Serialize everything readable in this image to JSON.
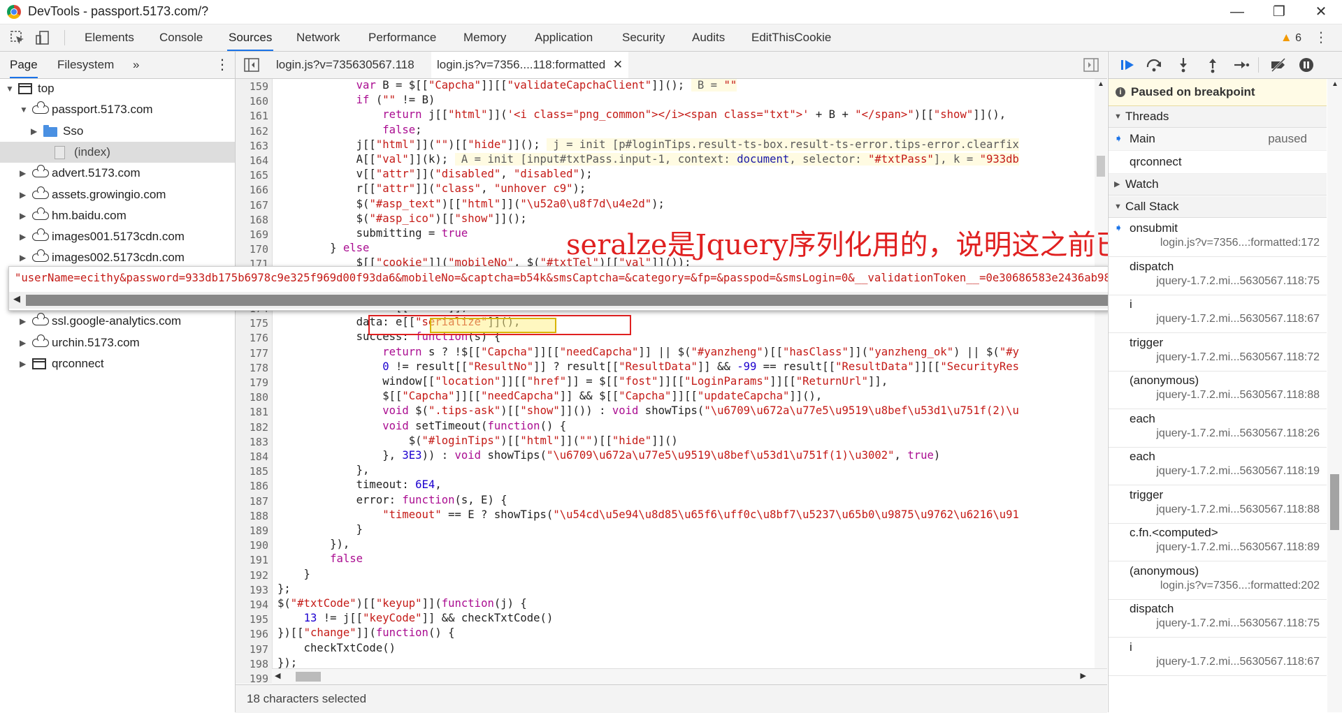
{
  "window": {
    "title": "DevTools - passport.5173.com/?",
    "minimize": "—",
    "maximize": "❐",
    "close": "✕"
  },
  "main_tabs": [
    "Elements",
    "Console",
    "Sources",
    "Network",
    "Performance",
    "Memory",
    "Application",
    "Security",
    "Audits",
    "EditThisCookie"
  ],
  "active_tab": "Sources",
  "warnings": {
    "icon": "warning-icon",
    "count": "6"
  },
  "navigator": {
    "tabs": [
      "Page",
      "Filesystem"
    ],
    "more": "»",
    "tree": [
      {
        "label": "top",
        "depth": 0,
        "icon": "frame",
        "arrow": "▼"
      },
      {
        "label": "passport.5173.com",
        "depth": 1,
        "icon": "cloud",
        "arrow": "▼"
      },
      {
        "label": "Sso",
        "depth": 2,
        "icon": "folder",
        "arrow": "▶"
      },
      {
        "label": "(index)",
        "depth": 3,
        "icon": "file",
        "arrow": "",
        "selected": true
      },
      {
        "label": "advert.5173.com",
        "depth": 1,
        "icon": "cloud",
        "arrow": "▶"
      },
      {
        "label": "assets.growingio.com",
        "depth": 1,
        "icon": "cloud",
        "arrow": "▶"
      },
      {
        "label": "hm.baidu.com",
        "depth": 1,
        "icon": "cloud",
        "arrow": "▶"
      },
      {
        "label": "images001.5173cdn.com",
        "depth": 1,
        "icon": "cloud",
        "arrow": "▶"
      },
      {
        "label": "images002.5173cdn.com",
        "depth": 1,
        "icon": "cloud",
        "arrow": "▶"
      },
      {
        "label": "ssl.google-analytics.com",
        "depth": 1,
        "icon": "cloud",
        "arrow": "▶",
        "row": 11
      },
      {
        "label": "urchin.5173.com",
        "depth": 1,
        "icon": "cloud",
        "arrow": "▶",
        "row": 12
      },
      {
        "label": "qrconnect",
        "depth": 1,
        "icon": "frame",
        "arrow": "▶",
        "row": 13
      }
    ]
  },
  "editor": {
    "tabs": [
      {
        "label": "login.js?v=735630567.118",
        "active": false
      },
      {
        "label": "login.js?v=7356....118:formatted",
        "active": true
      }
    ],
    "line_numbers": [
      "159",
      "160",
      "161",
      "162",
      "163",
      "164",
      "165",
      "166",
      "167",
      "168",
      "169",
      "170",
      "171",
      "",
      "",
      "174",
      "175",
      "176",
      "177",
      "178",
      "179",
      "180",
      "181",
      "182",
      "183",
      "184",
      "185",
      "186",
      "187",
      "188",
      "189",
      "190",
      "191",
      "192",
      "193",
      "194",
      "195",
      "196",
      "197",
      "198",
      "199"
    ],
    "status": "18 characters selected"
  },
  "popover": {
    "text": "\"userName=ecithy&password=933db175b6978c9e325f969d00f93da6&mobileNo=&captcha=b54k&smsCaptcha=&category=&fp=&passpod=&smsLogin=0&__validationToken__=0e30686583e2436ab980ca650f9a6ecb&__validati"
  },
  "annotation": "seralze是Jquery序列化用的，说明这之前已加密",
  "debugger": {
    "paused": "Paused on breakpoint",
    "sections": {
      "threads": "Threads",
      "watch": "Watch",
      "call_stack": "Call Stack"
    },
    "threads": [
      {
        "name": "Main",
        "status": "paused"
      },
      {
        "name": "qrconnect",
        "status": ""
      }
    ],
    "call_stack": [
      {
        "name": "onsubmit",
        "loc": "login.js?v=7356...:formatted:172"
      },
      {
        "name": "dispatch",
        "loc": "jquery-1.7.2.mi...5630567.118:75"
      },
      {
        "name": "i",
        "loc": "jquery-1.7.2.mi...5630567.118:67"
      },
      {
        "name": "trigger",
        "loc": "jquery-1.7.2.mi...5630567.118:72"
      },
      {
        "name": "(anonymous)",
        "loc": "jquery-1.7.2.mi...5630567.118:88"
      },
      {
        "name": "each",
        "loc": "jquery-1.7.2.mi...5630567.118:26"
      },
      {
        "name": "each",
        "loc": "jquery-1.7.2.mi...5630567.118:19"
      },
      {
        "name": "trigger",
        "loc": "jquery-1.7.2.mi...5630567.118:88"
      },
      {
        "name": "c.fn.<computed>",
        "loc": "jquery-1.7.2.mi...5630567.118:89"
      },
      {
        "name": "(anonymous)",
        "loc": "login.js?v=7356...:formatted:202"
      },
      {
        "name": "dispatch",
        "loc": "jquery-1.7.2.mi...5630567.118:75"
      },
      {
        "name": "i",
        "loc": "jquery-1.7.2.mi...5630567.118:67"
      }
    ]
  },
  "colors": {
    "accent": "#1a73e8",
    "annotation": "#e02020",
    "paused_bg": "#fffbe6",
    "string": "#c41a16",
    "keyword": "#aa0d91"
  }
}
